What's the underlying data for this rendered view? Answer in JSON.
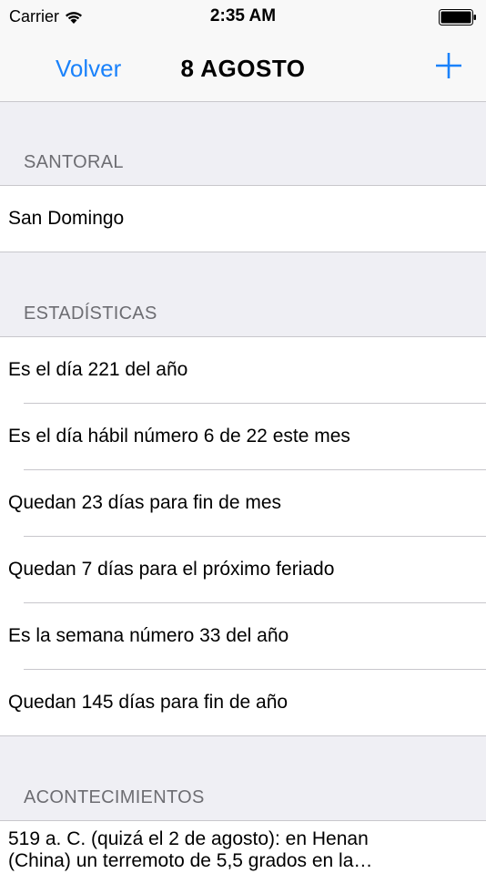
{
  "status_bar": {
    "carrier": "Carrier",
    "time": "2:35 AM"
  },
  "nav": {
    "back_label": "Volver",
    "title": "8 AGOSTO",
    "add_icon": "plus-icon",
    "accent_color": "#1a82fb"
  },
  "sections": {
    "santoral": {
      "header": "SANTORAL",
      "items": [
        "San Domingo"
      ]
    },
    "estadisticas": {
      "header": "ESTADÍSTICAS",
      "items": [
        "Es el día 221 del año",
        "Es el día hábil número 6 de 22 este mes",
        "Quedan 23 días para fin de mes",
        "Quedan 7 días para el próximo feriado",
        "Es la semana número 33 del año",
        "Quedan 145 días para fin de año"
      ]
    },
    "acontecimientos": {
      "header": "ACONTECIMIENTOS",
      "items": [
        "519 a. C. (quizá el 2 de agosto): en Henan (China) un terremoto de 5,5 grados en la…"
      ]
    }
  }
}
